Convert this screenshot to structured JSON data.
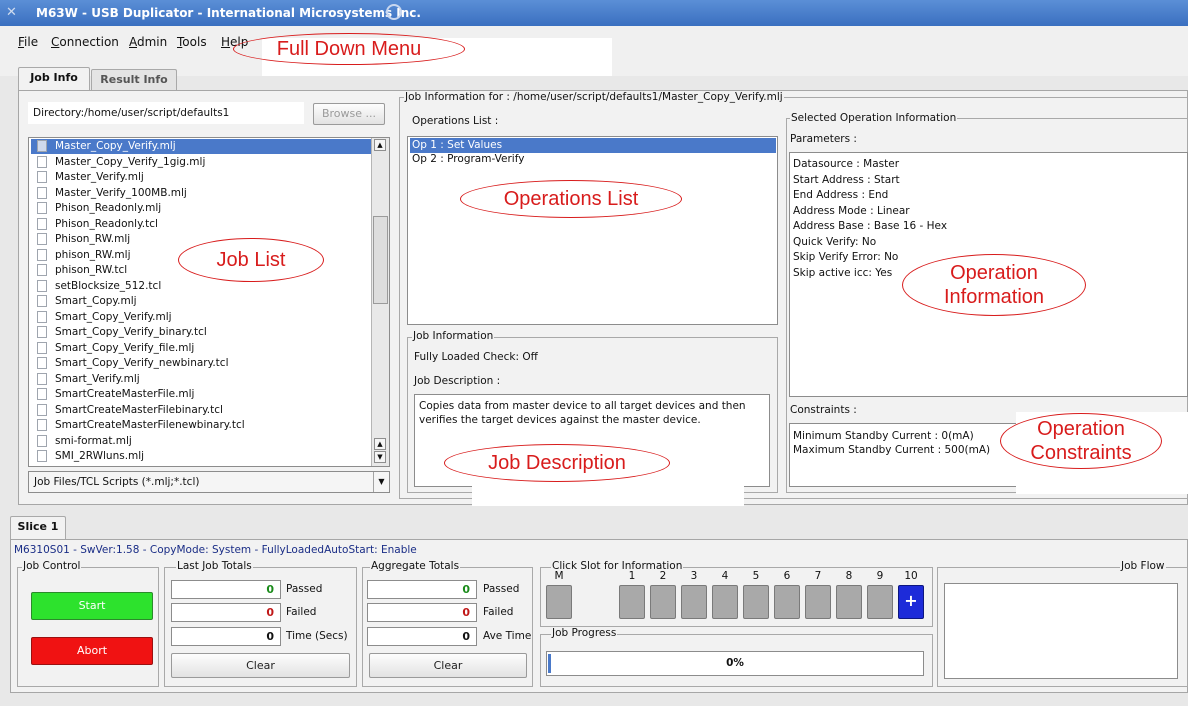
{
  "window": {
    "title": "M63W - USB Duplicator - International Microsystems Inc."
  },
  "menu": [
    "File",
    "Connection",
    "Admin",
    "Tools",
    "Help"
  ],
  "annotations": {
    "menu": "Full Down Menu",
    "job_list": "Job List",
    "operations_list": "Operations List",
    "operation_information": "Operation Information",
    "job_description": "Job Description",
    "operation_constraints": "Operation Constraints"
  },
  "tabs": [
    "Job Info",
    "Result Info"
  ],
  "job_info": {
    "directory": "Directory:/home/user/script/defaults1",
    "browse_label": "Browse ...",
    "jobs": [
      "Master_Copy_Verify.mlj",
      "Master_Copy_Verify_1gig.mlj",
      "Master_Verify.mlj",
      "Master_Verify_100MB.mlj",
      "Phison_Readonly.mlj",
      "Phison_Readonly.tcl",
      "Phison_RW.mlj",
      "phison_RW.mlj",
      "phison_RW.tcl",
      "setBlocksize_512.tcl",
      "Smart_Copy.mlj",
      "Smart_Copy_Verify.mlj",
      "Smart_Copy_Verify_binary.tcl",
      "Smart_Copy_Verify_file.mlj",
      "Smart_Copy_Verify_newbinary.tcl",
      "Smart_Verify.mlj",
      "SmartCreateMasterFile.mlj",
      "SmartCreateMasterFilebinary.tcl",
      "SmartCreateMasterFilenewbinary.tcl",
      "smi-format.mlj",
      "SMI_2RWluns.mlj"
    ],
    "filter": "Job Files/TCL Scripts (*.mlj;*.tcl)",
    "job_information_for": "Job Information for : /home/user/script/defaults1/Master_Copy_Verify.mlj",
    "operations_list_label": "Operations List :",
    "operations": [
      "Op 1 : Set Values",
      "Op 2 : Program-Verify"
    ],
    "job_information_label": "Job Information",
    "fully_loaded_check": "Fully Loaded Check:  Off",
    "job_description_label": "Job Description :",
    "job_description": "Copies data from master device to all target devices and then verifies the target devices against the master device.",
    "selected_op_info_label": "Selected Operation Information",
    "parameters_label": "Parameters :",
    "parameters": [
      "Datasource : Master",
      "Start Address : Start",
      "End Address  : End",
      "Address Mode : Linear",
      "Address Base : Base 16 - Hex",
      "Quick Verify: No",
      "Skip Verify Error: No",
      "Skip active icc: Yes"
    ],
    "constraints_label": "Constraints :",
    "constraints": [
      "Minimum Standby Current : 0(mA)",
      "Maximum Standby Current : 500(mA)"
    ]
  },
  "slice": {
    "tab": "Slice 1",
    "info": "M6310S01 - SwVer:1.58 - CopyMode: System - FullyLoadedAutoStart: Enable",
    "job_control_label": "Job Control",
    "start_label": "Start",
    "abort_label": "Abort",
    "last_job_totals_label": "Last Job Totals",
    "last_job": {
      "passed": "0",
      "failed": "0",
      "time": "0"
    },
    "passed_label": "Passed",
    "failed_label": "Failed",
    "time_label": "Time (Secs)",
    "clear_label": "Clear",
    "aggregate_totals_label": "Aggregate Totals",
    "aggregate": {
      "passed": "0",
      "failed": "0",
      "avetime": "0"
    },
    "ave_time_label": "Ave Time",
    "click_slot_label": "Click Slot for Information",
    "slots": [
      "M",
      "1",
      "2",
      "3",
      "4",
      "5",
      "6",
      "7",
      "8",
      "9",
      "10"
    ],
    "job_progress_label": "Job Progress",
    "progress": "0%",
    "job_flow_label": "Job Flow"
  }
}
